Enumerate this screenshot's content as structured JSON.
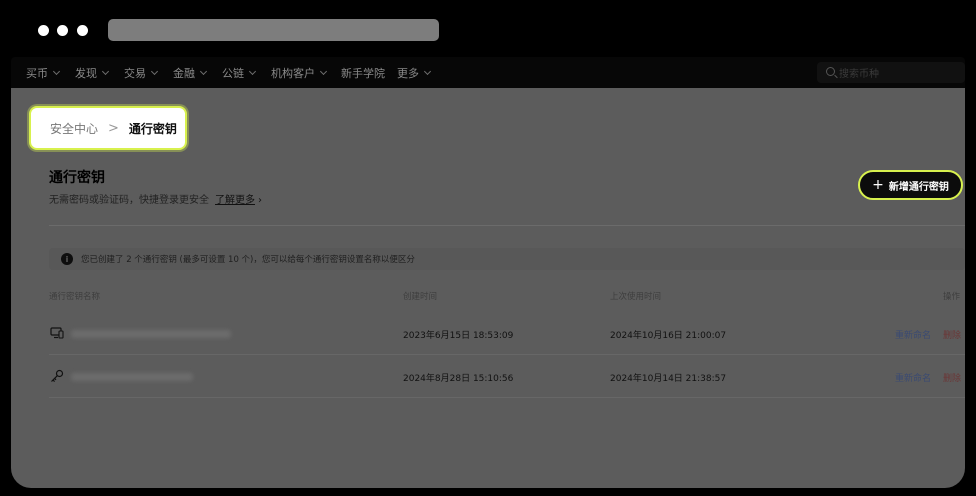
{
  "nav": {
    "items": [
      {
        "label": "买币",
        "dropdown": true
      },
      {
        "label": "发现",
        "dropdown": true
      },
      {
        "label": "交易",
        "dropdown": true
      },
      {
        "label": "金融",
        "dropdown": true
      },
      {
        "label": "公链",
        "dropdown": true
      },
      {
        "label": "机构客户",
        "dropdown": true
      },
      {
        "label": "新手学院",
        "dropdown": false
      },
      {
        "label": "更多",
        "dropdown": true
      }
    ],
    "search_placeholder": "搜索币种"
  },
  "breadcrumb": {
    "parent": "安全中心",
    "separator": ">",
    "current": "通行密钥"
  },
  "page": {
    "title": "通行密钥",
    "description": "无需密码或验证码，快捷登录更安全",
    "learn_more": "了解更多",
    "learn_more_arrow": "›",
    "add_button": "新增通行密钥",
    "add_icon": "+"
  },
  "notice": {
    "icon": "i",
    "text": "您已创建了 2 个通行密钥 (最多可设置 10 个)，您可以给每个通行密钥设置名称以便区分"
  },
  "table": {
    "headers": {
      "name": "通行密钥名称",
      "created": "创建时间",
      "last_used": "上次使用时间",
      "actions": "操作"
    },
    "rows": [
      {
        "icon": "device-icon",
        "created": "2023年6月15日 18:53:09",
        "last_used": "2024年10月16日 21:00:07",
        "rename": "重新命名",
        "delete": "删除"
      },
      {
        "icon": "key-icon",
        "created": "2024年8月28日 15:10:56",
        "last_used": "2024年10月14日 21:38:57",
        "rename": "重新命名",
        "delete": "删除"
      }
    ]
  },
  "colors": {
    "highlight": "#d8f14e",
    "overlay": "#5c5c5c",
    "button_bg": "#0c0c0c"
  }
}
